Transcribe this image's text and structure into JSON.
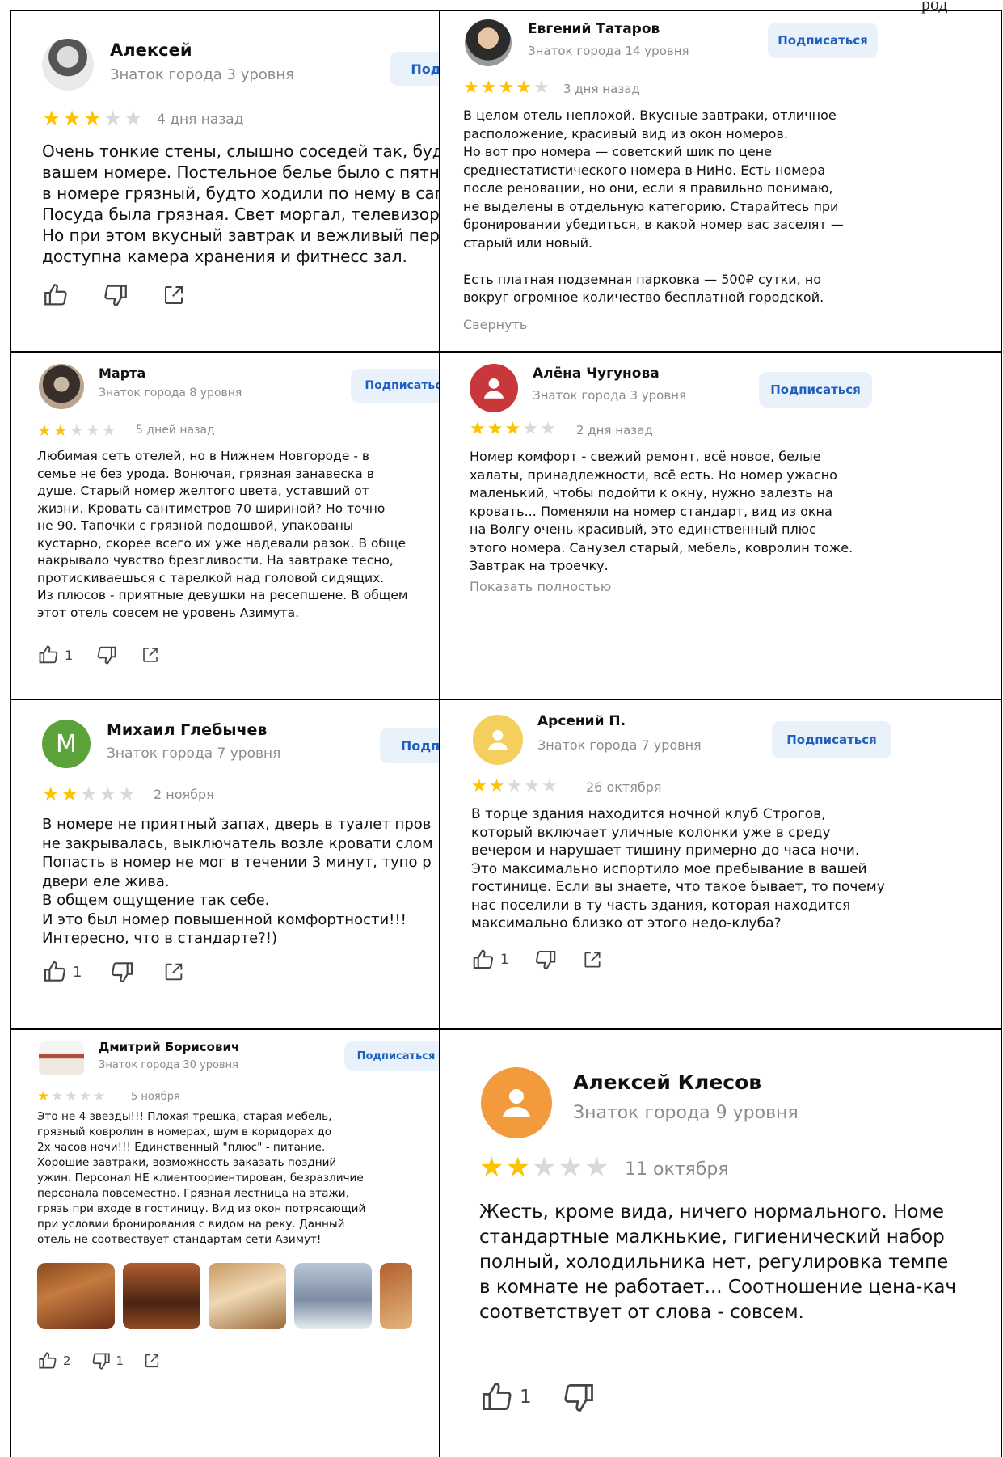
{
  "page": {
    "corner_text": "род"
  },
  "reviews": [
    {
      "name": "Алексей",
      "level": "Знаток города 3 уровня",
      "subscribe": "Под",
      "stars": 3,
      "date": "4 дня назад",
      "text": "Очень тонкие стены, слышно соседей так, будто\nвашем номере. Постельное белье было с пятна\nв номере грязный, будто ходили по нему в сапо\nПосуда была грязная. Свет моргал, телевизор р\nНо при этом вкусный завтрак и вежливый перс\nдоступна камера хранения и фитнесс зал.",
      "likes": "",
      "dislikes": ""
    },
    {
      "name": "Евгений Татаров",
      "level": "Знаток города 14 уровня",
      "subscribe": "Подписаться",
      "stars": 4,
      "date": "3 дня назад",
      "text": "В целом отель неплохой. Вкусные завтраки, отличное\nрасположение, красивый вид из окон номеров.\nНо вот про номера — советский шик по цене\nсреднестатистического номера в НиНо. Есть номера\nпосле реновации, но они, если я правильно понимаю,\nне выделены в отдельную категорию. Старайтесь при\nбронировании убедиться, в какой номер вас заселят —\nстарый или новый.\n\nЕсть платная подземная парковка — 500₽ сутки, но\nвокруг огромное количество бесплатной городской.",
      "link": "Свернуть"
    },
    {
      "name": "Марта",
      "level": "Знаток города 8 уровня",
      "subscribe": "Подписатьс",
      "stars": 2,
      "date": "5 дней назад",
      "text": "Любимая сеть отелей, но в Нижнем Новгороде - в\nсемье не без урода. Вонючая, грязная занавеска в\nдуше. Старый номер желтого цвета, уставший от\nжизни. Кровать сантиметров 70 шириной? Но точно\nне 90.  Тапочки с грязной подошвой, упакованы\nкустарно, скорее всего их уже надевали разок. В обще\nнакрывало чувство брезгливости.  На завтраке тесно,\nпротискиваешься с тарелкой над головой сидящих.\nИз плюсов - приятные девушки на ресепшене. В общем\nэтот отель совсем не уровень Азимута.",
      "likes": "1"
    },
    {
      "name": "Алёна Чугунова",
      "level": "Знаток города 3 уровня",
      "subscribe": "Подписаться",
      "stars": 3,
      "date": "2 дня назад",
      "text": "Номер комфорт - свежий ремонт, всё новое, белые\nхалаты, принадлежности, всё есть. Но номер ужасно\nмаленький, чтобы подойти к окну, нужно залезть на\nкровать... Поменяли на номер стандарт, вид из окна\nна Волгу очень красивый, это единственный плюс\nэтого номера. Санузел старый, мебель, ковролин тоже.\nЗавтрак на троечку.",
      "link": "Показать полностью"
    },
    {
      "name": "Михаил Глебычев",
      "initial": "М",
      "level": "Знаток города 7 уровня",
      "subscribe": "Подп",
      "stars": 2,
      "date": "2 ноября",
      "text": "В номере не приятный запах, дверь в туалет пров\nне закрывалась, выключатель возле кровати слом\nПопасть в номер не мог в течении 3 минут, тупо р\nдвери еле жива.\nВ общем ощущение так себе.\nИ это был номер повышенной комфортности!!!\nИнтересно, что в стандарте?!)",
      "likes": "1"
    },
    {
      "name": "Арсений П.",
      "level": "Знаток города 7 уровня",
      "subscribe": "Подписаться",
      "stars": 2,
      "date": "26 октября",
      "text": "В торце здания находится ночной клуб Строгов,\nкоторый включает уличные колонки уже в среду\nвечером и нарушает тишину примерно до часа ночи.\nЭто максимально испортило мое пребывание в вашей\nгостинице. Если вы знаете, что такое бывает, то почему\nнас поселили в ту часть здания, которая находится\nмаксимально близко от этого недо-клуба?",
      "likes": "1"
    },
    {
      "name": "Дмитрий Борисович",
      "level": "Знаток города 30 уровня",
      "subscribe": "Подписаться",
      "stars": 1,
      "date": "5 ноября",
      "text": "Это не 4 звезды!!! Плохая трешка, старая мебель,\nгрязный ковролин в номерах, шум в коридорах до\n2х часов ночи!!! Единственный \"плюс\" - питание.\nХорошие завтраки, возможность заказать поздний\nужин. Персонал НЕ клиентоориентирован, безразличие\nперсонала повсеместно. Грязная лестница на этажи,\nгрязь при входе в гостиницу. Вид из окон потрясающий\nпри условии бронирования с видом на реку. Данный\nотель не соотвествует стандартам сети Азимут!",
      "likes": "2",
      "dislikes": "1"
    },
    {
      "name": "Алексей Клесов",
      "level": "Знаток города 9 уровня",
      "stars": 2,
      "date": "11 октября",
      "text": "Жесть, кроме вида, ничего нормального. Номе\nстандартные малкнькие, гигиенический набор\nполный, холодильника нет, регулировка темпе\nв комнате не работает... Соотношение цена-кач\nсоответствует от слова - совсем.",
      "likes": "1"
    }
  ],
  "colors": {
    "star_on": "#fcc400",
    "star_off": "#d9d9d9",
    "subscribe_bg": "#e9f1fb",
    "subscribe_text": "#1f5fbf"
  },
  "icons": {
    "like": "thumbs-up-icon",
    "dislike": "thumbs-down-icon",
    "share": "share-icon",
    "person": "person-icon"
  }
}
